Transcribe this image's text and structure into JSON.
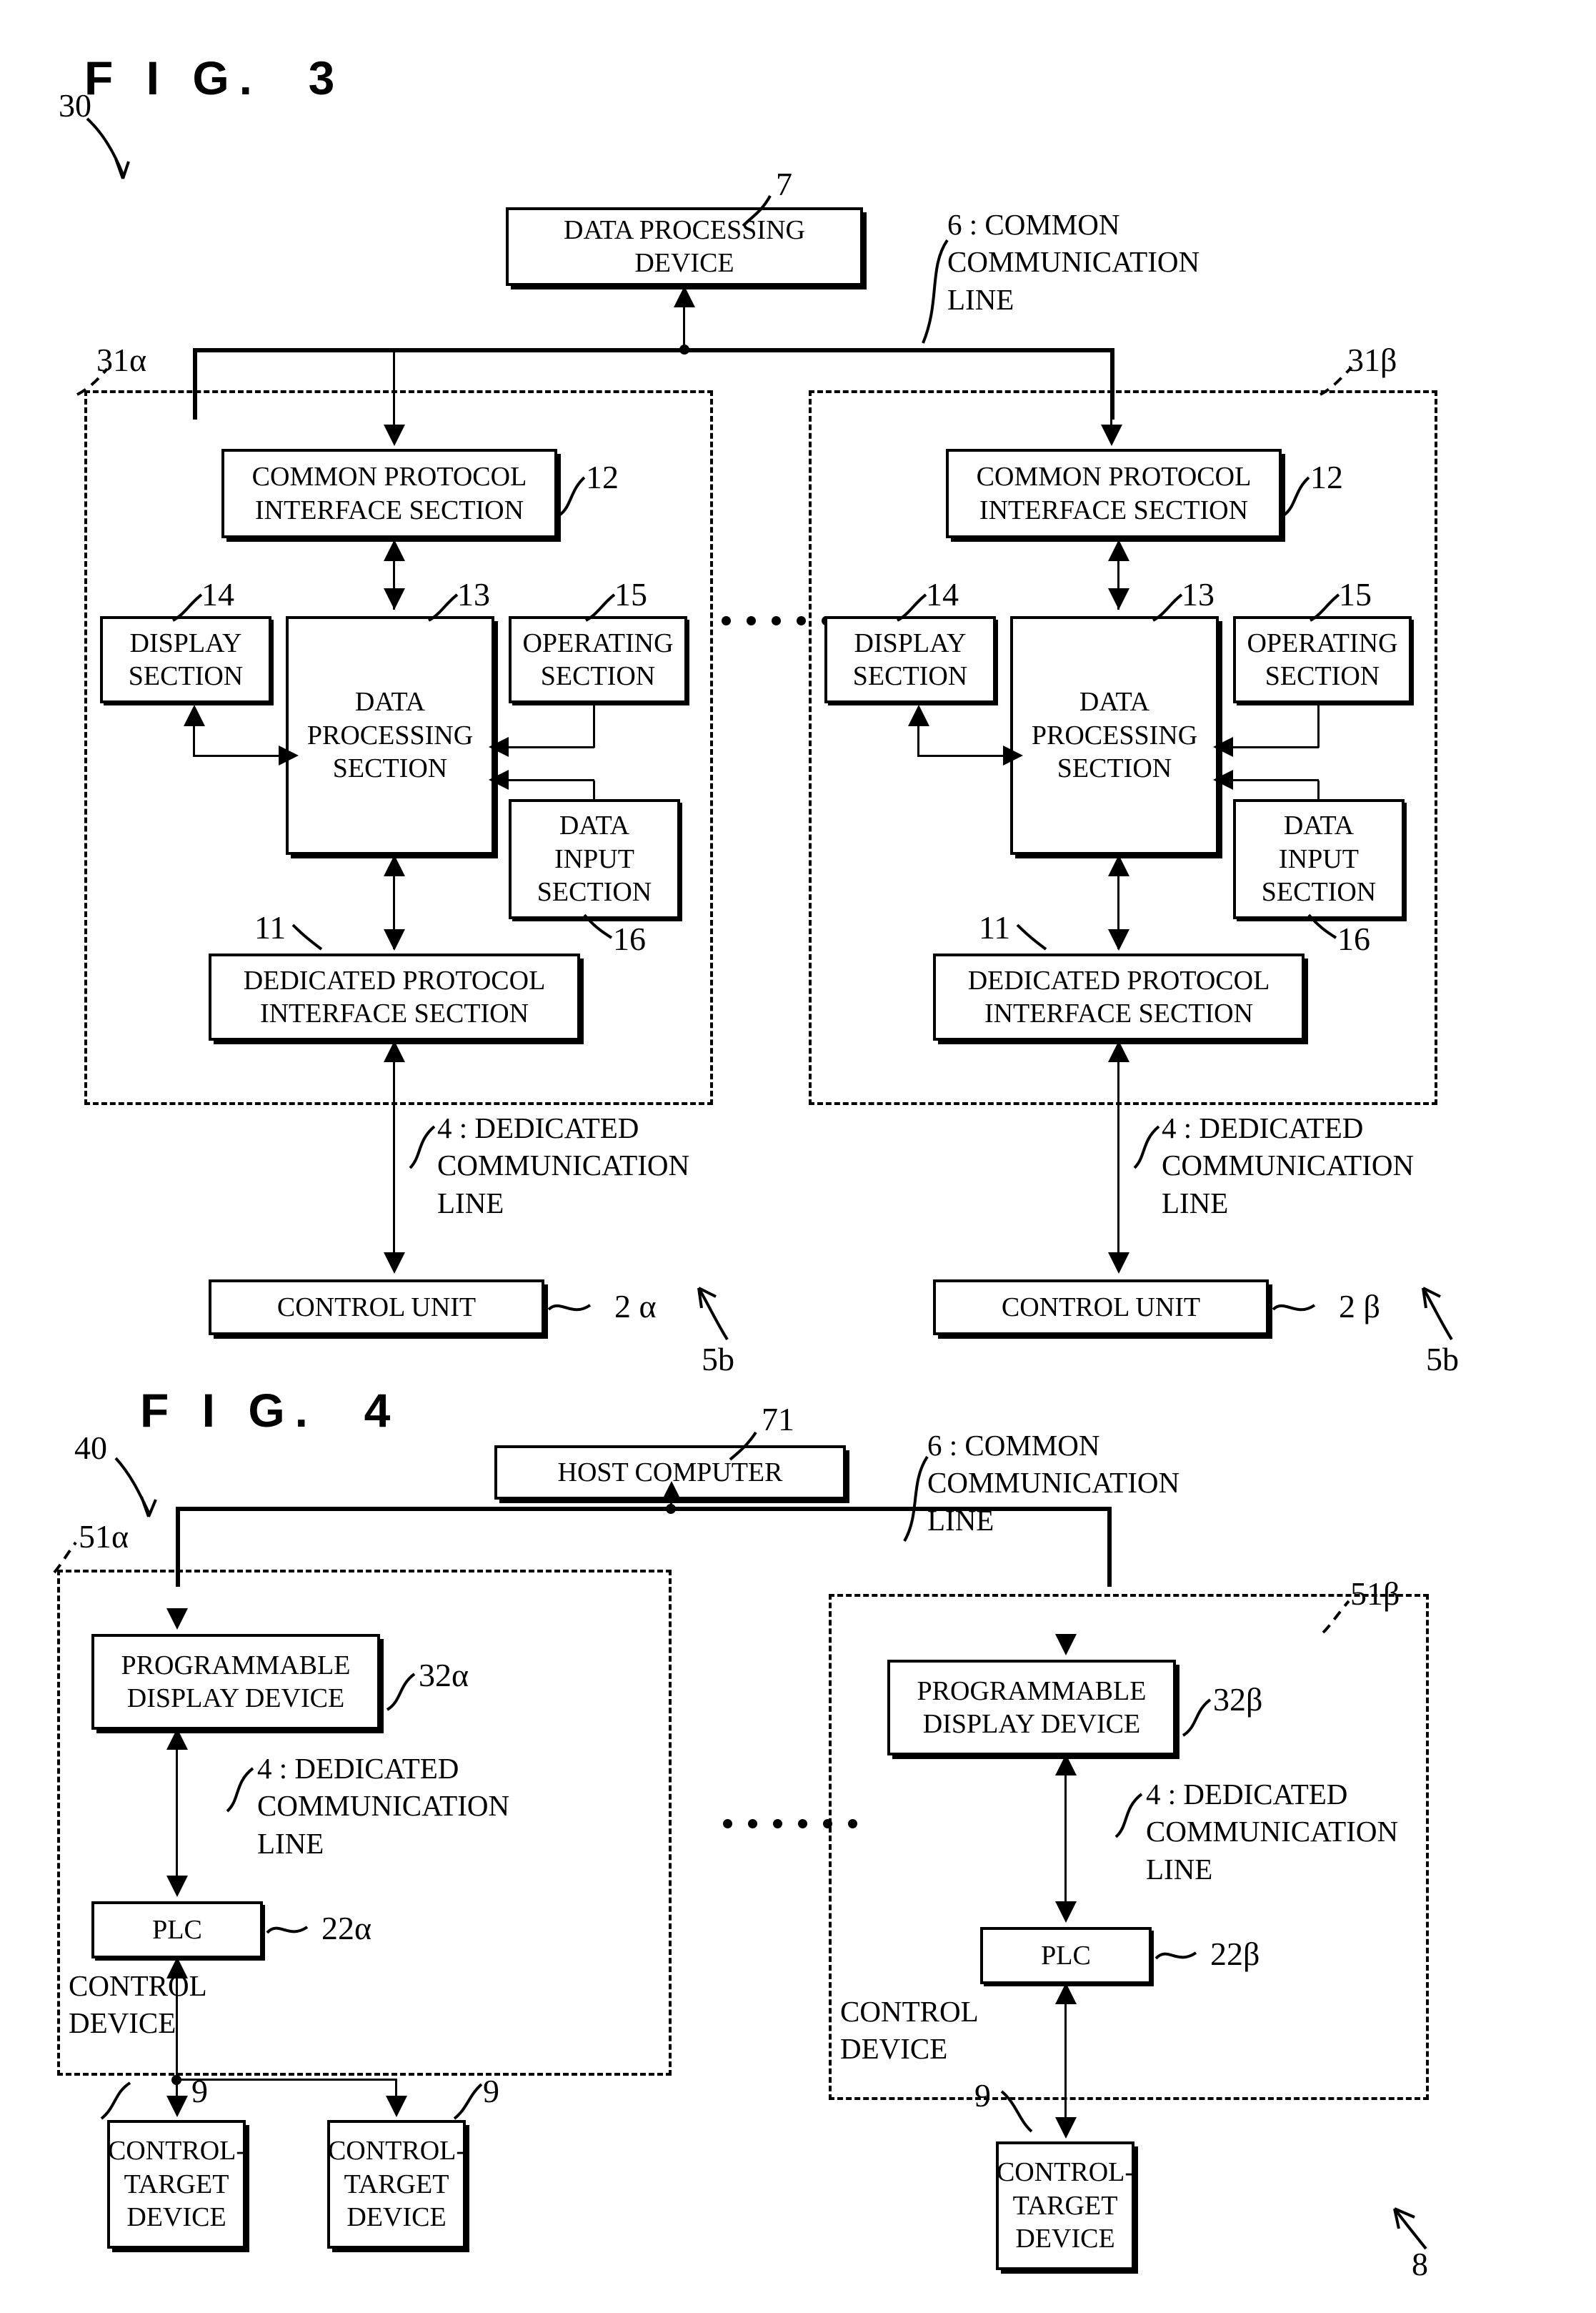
{
  "figures": [
    {
      "id": "fig3",
      "title": "F I G.  3",
      "system_ref": "30",
      "top_box": {
        "label": "DATA PROCESSING\nDEVICE",
        "ref": "7"
      },
      "common_line_label": "6 : COMMON\nCOMMUNICATION\nLINE",
      "panels": [
        {
          "ref": "31α",
          "blocks": [
            {
              "name": "common-protocol-interface-section",
              "label": "COMMON PROTOCOL\nINTERFACE SECTION",
              "ref": "12"
            },
            {
              "name": "display-section",
              "label": "DISPLAY\nSECTION",
              "ref": "14"
            },
            {
              "name": "data-processing-section",
              "label": "DATA\nPROCESSING\nSECTION",
              "ref": "13"
            },
            {
              "name": "operating-section",
              "label": "OPERATING\nSECTION",
              "ref": "15"
            },
            {
              "name": "data-input-section",
              "label": "DATA\nINPUT\nSECTION",
              "ref": "16"
            },
            {
              "name": "dedicated-protocol-interface-section",
              "label": "DEDICATED PROTOCOL\nINTERFACE SECTION",
              "ref": "11"
            }
          ],
          "dedicated_line_label": "4 : DEDICATED\nCOMMUNICATION\nLINE",
          "control_unit": {
            "label": "CONTROL UNIT",
            "ref": "2 α"
          },
          "group_ref": "5b"
        },
        {
          "ref": "31β",
          "blocks": [
            {
              "name": "common-protocol-interface-section",
              "label": "COMMON PROTOCOL\nINTERFACE SECTION",
              "ref": "12"
            },
            {
              "name": "display-section",
              "label": "DISPLAY\nSECTION",
              "ref": "14"
            },
            {
              "name": "data-processing-section",
              "label": "DATA\nPROCESSING\nSECTION",
              "ref": "13"
            },
            {
              "name": "operating-section",
              "label": "OPERATING\nSECTION",
              "ref": "15"
            },
            {
              "name": "data-input-section",
              "label": "DATA\nINPUT\nSECTION",
              "ref": "16"
            },
            {
              "name": "dedicated-protocol-interface-section",
              "label": "DEDICATED PROTOCOL\nINTERFACE SECTION",
              "ref": "11"
            }
          ],
          "dedicated_line_label": "4 : DEDICATED\nCOMMUNICATION\nLINE",
          "control_unit": {
            "label": "CONTROL UNIT",
            "ref": "2 β"
          },
          "group_ref": "5b"
        }
      ]
    },
    {
      "id": "fig4",
      "title": "F I G.  4",
      "system_ref": "40",
      "top_box": {
        "label": "HOST COMPUTER",
        "ref": "71"
      },
      "common_line_label": "6 : COMMON\nCOMMUNICATION\nLINE",
      "panels": [
        {
          "ref": "51α",
          "display_device": {
            "label": "PROGRAMMABLE\nDISPLAY DEVICE",
            "ref": "32α"
          },
          "dedicated_line_label": "4 : DEDICATED\nCOMMUNICATION\nLINE",
          "plc": {
            "label": "PLC",
            "ref": "22α"
          },
          "control_device_label": "CONTROL\nDEVICE",
          "targets": [
            {
              "label": "CONTROL-\nTARGET\nDEVICE",
              "ref": "9"
            },
            {
              "label": "CONTROL-\nTARGET\nDEVICE",
              "ref": "9"
            }
          ]
        },
        {
          "ref": "51β",
          "display_device": {
            "label": "PROGRAMMABLE\nDISPLAY DEVICE",
            "ref": "32β"
          },
          "dedicated_line_label": "4 : DEDICATED\nCOMMUNICATION\nLINE",
          "plc": {
            "label": "PLC",
            "ref": "22β"
          },
          "control_device_label": "CONTROL\nDEVICE",
          "targets": [
            {
              "label": "CONTROL-\nTARGET\nDEVICE",
              "ref": "9"
            }
          ]
        }
      ],
      "system_ref_bottom": "8"
    }
  ]
}
